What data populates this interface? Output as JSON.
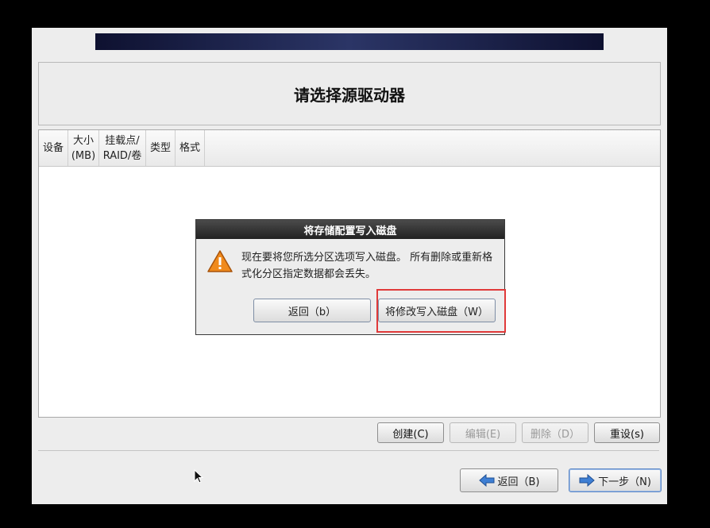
{
  "page": {
    "title": "请选择源驱动器"
  },
  "table": {
    "columns": [
      "设备",
      "大小\n(MB)",
      "挂载点/\nRAID/卷",
      "类型",
      "格式"
    ]
  },
  "toolbar": {
    "create": "创建(C)",
    "edit": "编辑(E)",
    "delete": "删除（D）",
    "reset": "重设(s)"
  },
  "nav": {
    "back": "返回（B)",
    "next": "下一步（N)"
  },
  "dialog": {
    "title": "将存储配置写入磁盘",
    "message": "现在要将您所选分区选项写入磁盘。  所有删除或重新格式化分区指定数据都会丢失。",
    "back_button": "返回（b）",
    "write_button": "将修改写入磁盘（W）"
  },
  "colors": {
    "highlight": "#e03a3a",
    "banner": "#1b2250",
    "warning": "#f08a1c"
  }
}
